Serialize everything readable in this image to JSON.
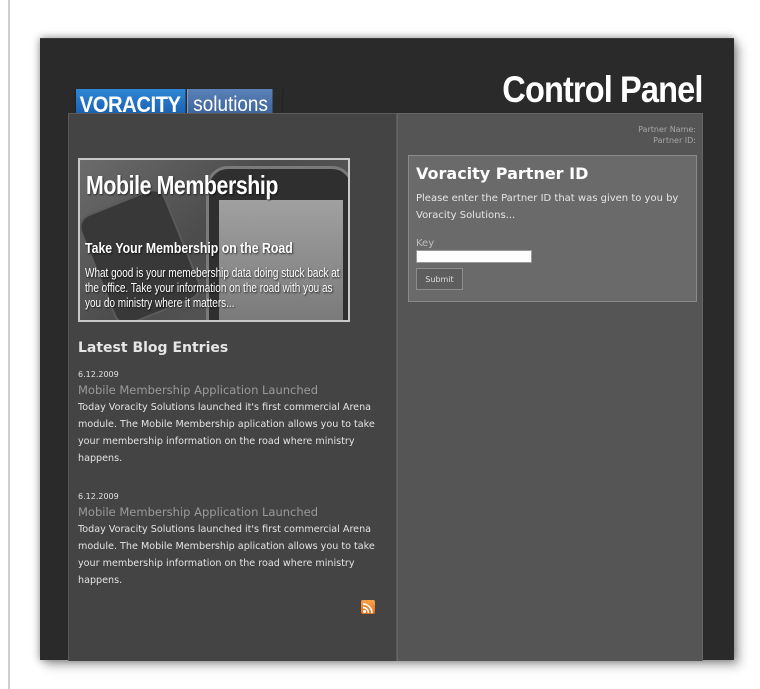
{
  "header": {
    "logo_primary": "VORACITY",
    "logo_secondary": "solutions",
    "page_title": "Control Panel"
  },
  "partner": {
    "name_label": "Partner Name:",
    "id_label": "Partner ID:"
  },
  "partner_form": {
    "title": "Voracity Partner ID",
    "description": "Please enter the Partner ID that was given to you by Voracity Solutions...",
    "key_label": "Key",
    "key_value": "",
    "submit_label": "Submit"
  },
  "banner": {
    "title": "Mobile Membership",
    "subtitle": "Take Your Membership on the Road",
    "text": "What good is your memebership data doing stuck back at the office. Take your information on the road with you as you do ministry where it matters..."
  },
  "blog": {
    "heading": "Latest Blog Entries",
    "entries": [
      {
        "date": "6.12.2009",
        "title": "Mobile Membership Application Launched",
        "body": "Today Voracity Solutions launched it's first commercial Arena module. The Mobile Membership aplication allows you to take your membership information on the road where ministry happens."
      },
      {
        "date": "6.12.2009",
        "title": "Mobile Membership Application Launched",
        "body": "Today Voracity Solutions launched it's first commercial Arena module. The Mobile Membership aplication allows you to take your membership information on the road where ministry happens."
      }
    ],
    "feed_icon": "rss-icon"
  },
  "colors": {
    "frame": "#2a2a2a",
    "left_panel": "#444444",
    "right_panel": "#555555",
    "logo_blue": "#1f6fc4",
    "rss_orange": "#e8771f"
  }
}
